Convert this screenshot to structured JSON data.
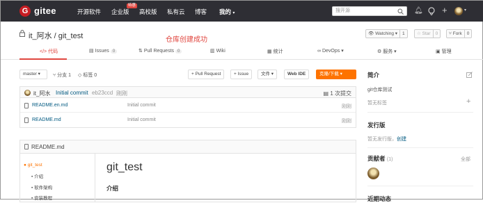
{
  "nav": {
    "logo_mark": "G",
    "logo_text": "gitee",
    "items": [
      "开源软件",
      "企业版",
      "高校版",
      "私有云",
      "博客"
    ],
    "badge": "特惠",
    "mine": "我的",
    "search_placeholder": "搜开源"
  },
  "repo": {
    "owner": "it_阿水",
    "sep": " / ",
    "name": "git_test",
    "success_message": "仓库创建成功",
    "watch": {
      "label": "Watching",
      "count": "1"
    },
    "star": {
      "label": "Star",
      "count": "0"
    },
    "fork": {
      "label": "Fork",
      "count": "0"
    }
  },
  "tabs": [
    {
      "label": "代码",
      "count": ""
    },
    {
      "label": "Issues",
      "count": "0"
    },
    {
      "label": "Pull Requests",
      "count": "0"
    },
    {
      "label": "Wiki",
      "count": ""
    },
    {
      "label": "统计",
      "count": ""
    },
    {
      "label": "DevOps",
      "count": ""
    },
    {
      "label": "服务",
      "count": ""
    },
    {
      "label": "管理",
      "count": ""
    }
  ],
  "toolbar": {
    "branch": "master",
    "branches": "分支 1",
    "tags": "标签 0",
    "pull_request": "+ Pull Request",
    "issue": "+ Issue",
    "file": "文件",
    "web_ide": "Web IDE",
    "download": "克隆/下载"
  },
  "commit": {
    "author": "it_阿水",
    "message": "Initial commit",
    "hash": "eb23ccd",
    "time": "刚刚",
    "count": "1 次提交"
  },
  "files": [
    {
      "name": "README.en.md",
      "message": "Initial commit",
      "time": "刚刚"
    },
    {
      "name": "README.md",
      "message": "Initial commit",
      "time": "刚刚"
    }
  ],
  "readme": {
    "filename": "README.md",
    "toc": [
      "git_test",
      "介绍",
      "软件架构",
      "安装教程"
    ],
    "h1": "git_test",
    "h2": "介绍"
  },
  "sidebar": {
    "intro_title": "简介",
    "intro_text": "git仓库测试",
    "no_tags": "暂无标签",
    "release_title": "发行版",
    "no_release": "暂无发行版，",
    "create": "创建",
    "contributors_title": "贡献者",
    "contributors_count": "(1)",
    "all": "全部",
    "recent_title": "近期动态"
  },
  "colors": {
    "accent": "#e0463f",
    "download": "#fe7300",
    "topbar": "#2e2e34",
    "link": "#005980"
  }
}
